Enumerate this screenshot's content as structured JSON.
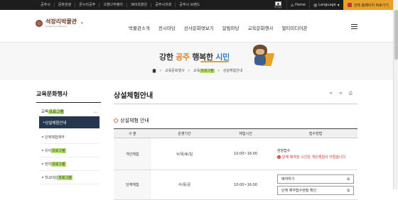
{
  "topbar": {
    "links": [
      "공주시",
      "문화관광",
      "온누리공주",
      "고향나부랭이",
      "365초밝은",
      "공주시의회",
      "공주시 브랜드"
    ],
    "gov_label": "국가상징",
    "home": "Home",
    "language": "Language",
    "goto_label": "전체 홈페이지 바로가기"
  },
  "logo": {
    "name": "석장리박물관",
    "sub": "Seokjang-ri Museum"
  },
  "gnb": [
    "박물관소개",
    "전시마당",
    "선사문화엿보기",
    "알림마당",
    "교육문화행사",
    "멀티미디어관"
  ],
  "visual": {
    "slogan_1": "강한 ",
    "slogan_2": "공주",
    "slogan_3": " 행복한 ",
    "slogan_4": "시민"
  },
  "breadcrumb": {
    "l1": "교육문화행사",
    "l2a": "교육",
    "l2b": "프로그램",
    "l3": "상설체험안내"
  },
  "lnb": {
    "title": "교육문화행사",
    "group_a": "교육",
    "group_b": "프로그램",
    "active": "상설체험안내",
    "items": [
      {
        "a": "단체체험예약",
        "b": ""
      },
      {
        "a": "유아",
        "b": "프로그램"
      },
      {
        "a": "방학",
        "b": "프로그램"
      },
      {
        "a": "학교대상",
        "b": "프로그램"
      }
    ]
  },
  "page": {
    "title": "상설체험안내"
  },
  "section": {
    "title": "상설체험 안내"
  },
  "table": {
    "headers": [
      "구 분",
      "운영기간",
      "체험시간",
      "접수방법"
    ],
    "rows": [
      {
        "cat": "개인체험",
        "period": "수/목/토/일",
        "time": "10:00~16:00",
        "status": "현장접수",
        "msg": "단체 예약된 시간은 개인체험이 어렵습니다."
      },
      {
        "cat": "단체체험",
        "period": "수/목/금",
        "time": "10:00~16:00",
        "btn1": "예약하기",
        "btn2": "단체 예약접수현황 확인"
      }
    ]
  },
  "colors": {
    "nav_active": "#26364f",
    "accent": "#e8a22a",
    "highlight": "#b5e06a",
    "error": "#d32f2f"
  }
}
